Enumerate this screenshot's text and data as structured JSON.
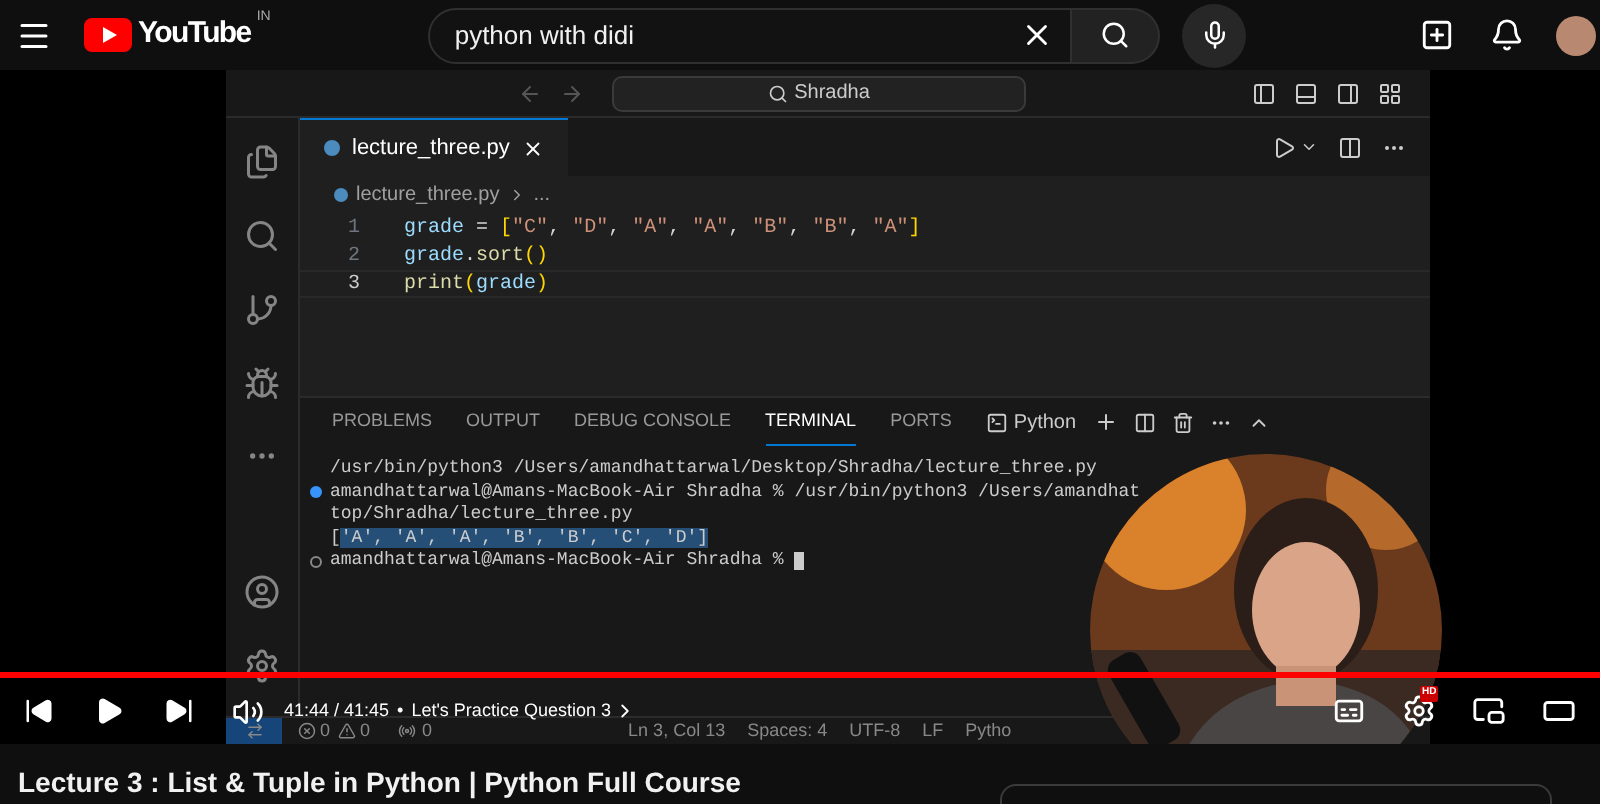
{
  "header": {
    "logo": "YouTube",
    "country": "IN",
    "search": {
      "value": "python with didi"
    }
  },
  "editor": {
    "command_center": "Shradha",
    "tabs": [
      {
        "label": "lecture_three.py",
        "selected": true
      }
    ],
    "breadcrumb": {
      "file": "lecture_three.py",
      "rest": "..."
    },
    "lines": [
      {
        "number": "1",
        "current": false,
        "tokens": [
          {
            "kind": "name",
            "text": "grade"
          },
          {
            "kind": "op",
            "text": " = "
          },
          {
            "kind": "bracket",
            "text": "["
          },
          {
            "kind": "str",
            "text": "\"C\""
          },
          {
            "kind": "op",
            "text": ", "
          },
          {
            "kind": "str",
            "text": "\"D\""
          },
          {
            "kind": "op",
            "text": ", "
          },
          {
            "kind": "str",
            "text": "\"A\""
          },
          {
            "kind": "op",
            "text": ", "
          },
          {
            "kind": "str",
            "text": "\"A\""
          },
          {
            "kind": "op",
            "text": ", "
          },
          {
            "kind": "str",
            "text": "\"B\""
          },
          {
            "kind": "op",
            "text": ", "
          },
          {
            "kind": "str",
            "text": "\"B\""
          },
          {
            "kind": "op",
            "text": ", "
          },
          {
            "kind": "str",
            "text": "\"A\""
          },
          {
            "kind": "bracket",
            "text": "]"
          }
        ]
      },
      {
        "number": "2",
        "current": false,
        "tokens": [
          {
            "kind": "name",
            "text": "grade"
          },
          {
            "kind": "op",
            "text": "."
          },
          {
            "kind": "fn",
            "text": "sort"
          },
          {
            "kind": "bracket",
            "text": "()"
          }
        ]
      },
      {
        "number": "3",
        "current": true,
        "tokens": [
          {
            "kind": "fn",
            "text": "print"
          },
          {
            "kind": "bracket",
            "text": "("
          },
          {
            "kind": "name",
            "text": "grade"
          },
          {
            "kind": "bracket",
            "text": ")"
          }
        ]
      }
    ]
  },
  "panel": {
    "tabs": [
      {
        "label": "PROBLEMS",
        "selected": false
      },
      {
        "label": "OUTPUT",
        "selected": false
      },
      {
        "label": "DEBUG CONSOLE",
        "selected": false
      },
      {
        "label": "TERMINAL",
        "selected": true
      },
      {
        "label": "PORTS",
        "selected": false
      }
    ],
    "shell": "Python",
    "lines": [
      {
        "kind": "output",
        "cursor": false,
        "segments": [
          {
            "selected": false,
            "text": "/usr/bin/python3 /Users/amandhattarwal/Desktop/Shradha/lecture_three.py"
          }
        ]
      },
      {
        "kind": "success",
        "cursor": false,
        "segments": [
          {
            "selected": false,
            "text": "amandhattarwal@Amans-MacBook-Air Shradha % /usr/bin/python3 /Users/amandhat"
          }
        ]
      },
      {
        "kind": "output",
        "cursor": false,
        "segments": [
          {
            "selected": false,
            "text": "top/Shradha/lecture_three.py"
          }
        ]
      },
      {
        "kind": "output",
        "cursor": false,
        "segments": [
          {
            "selected": false,
            "text": "["
          },
          {
            "selected": true,
            "text": "'A', 'A', 'A', 'B', 'B', 'C', 'D']"
          }
        ]
      },
      {
        "kind": "prompt",
        "cursor": true,
        "segments": [
          {
            "selected": false,
            "text": "amandhattarwal@Amans-MacBook-Air Shradha % "
          }
        ]
      }
    ]
  },
  "status_bar": {
    "errors": "0",
    "warnings": "0",
    "ports": "0",
    "items": [
      "Ln 3, Col 13",
      "Spaces: 4",
      "UTF-8",
      "LF",
      "Pytho"
    ]
  },
  "player": {
    "progress": {
      "level": 0.9996
    },
    "paused": true,
    "time": "41:44 / 41:45",
    "separator": "•",
    "chapter": "Let's Practice Question 3",
    "quality_badge": "HD"
  },
  "video_title": "Lecture 3 : List & Tuple in Python | Python Full Course"
}
